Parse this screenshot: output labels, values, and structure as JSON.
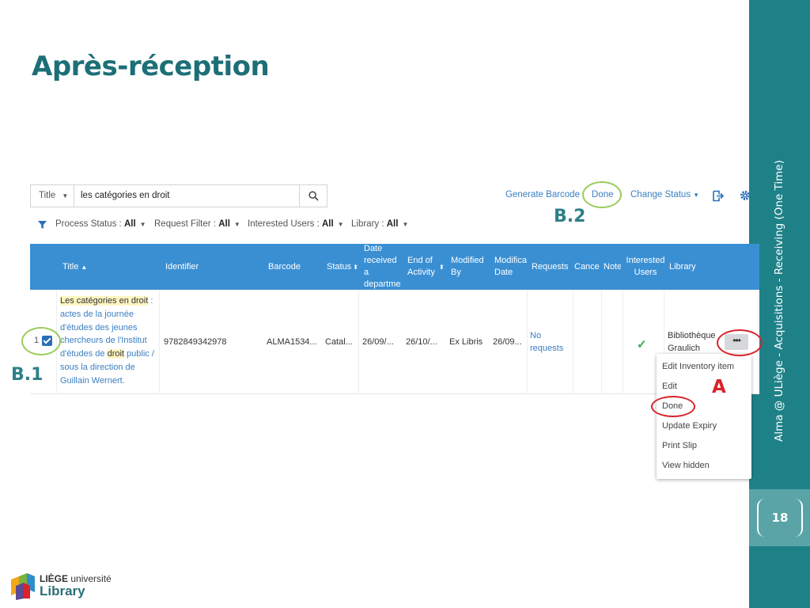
{
  "slide": {
    "title": "Après-réception",
    "side_text": "Alma @ ULiège - Acquisitions - Receiving (One Time)",
    "page_number": "18",
    "accent": "#1f8188",
    "callouts": {
      "b2": "B.2",
      "b1": "B.1",
      "a": "A"
    },
    "callout_colors": {
      "ring_green": "#9acd5c",
      "ring_red": "#d8232a"
    },
    "logo": {
      "line1_bold": "LIÈGE",
      "line1_rest": "université",
      "line2": "Library"
    }
  },
  "search": {
    "type": "Title",
    "value": "les catégories en droit",
    "icon": "search-icon"
  },
  "toolbar": {
    "generate_barcode": "Generate Barcode",
    "done": "Done",
    "change_status": "Change Status",
    "export_icon": "export-icon",
    "settings_icon": "gear-icon"
  },
  "filters": [
    {
      "label": "Process Status :",
      "value": "All"
    },
    {
      "label": "Request Filter :",
      "value": "All"
    },
    {
      "label": "Interested Users :",
      "value": "All"
    },
    {
      "label": "Library :",
      "value": "All"
    }
  ],
  "table": {
    "columns": [
      "Title",
      "Identifier",
      "Barcode",
      "Status",
      "Date received a departme",
      "End of Activity",
      "Modified By",
      "Modifica Date",
      "Requests",
      "Cance",
      "Note",
      "Interested Users",
      "Library"
    ],
    "row": {
      "index": "1",
      "title_highlight": "Les catégories en droit",
      "title_rest1": " : actes de la journée d'études des jeunes chercheurs de l'Institut d'études de ",
      "title_highlight2": "droit",
      "title_rest2": " public / sous la direction de Guillain Wernert.",
      "identifier": "9782849342978",
      "barcode": "ALMA1534...",
      "status": "Catal...",
      "date_received": "26/09/...",
      "end_of_activity": "26/10/...",
      "modified_by": "Ex Libris",
      "modification_date": "26/09...",
      "requests": "No requests",
      "library": "Bibliothèque Graulich",
      "row_actions": "•••"
    }
  },
  "row_menu": [
    "Edit Inventory item",
    "Edit",
    "Done",
    "Update Expiry",
    "Print Slip",
    "View hidden"
  ]
}
